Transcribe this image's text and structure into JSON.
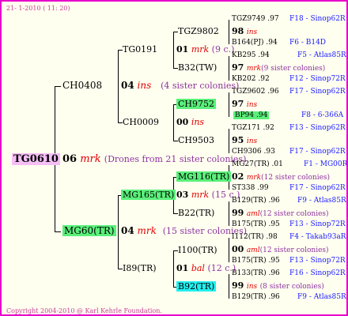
{
  "header": "21-  1-2010 ( 11: 20)",
  "footer": "Copyright 2004-2010 @ Karl Kehrle Foundation.",
  "root": {
    "id": "TG0610",
    "year": "06",
    "type": "mrk",
    "note": "(Drones from 21 sister colonies)"
  },
  "queens": {
    "upper": {
      "id": "CH0408",
      "year": "04",
      "type": "ins",
      "note": "(4 sister colonies)"
    },
    "lower": {
      "id": "MG60(TR)",
      "year": "04",
      "type": "mrk",
      "note": "(15 sister colonies)"
    }
  },
  "gen3": {
    "a": {
      "id": "TG0191",
      "year": "01",
      "type": "mrk",
      "note": "(9 c.)"
    },
    "b": {
      "id": "CH0009",
      "year": "00",
      "type": "ins"
    },
    "c": {
      "id": "MG165(TR)",
      "year": "03",
      "type": "mrk",
      "note": "(15 c.)"
    },
    "d": {
      "id": "I89(TR)",
      "year": "01",
      "type": "bal",
      "note": "(12 c.)"
    }
  },
  "gen4": {
    "a1": "TGZ9802",
    "a2": "B32(TW)",
    "b1": "CH9752",
    "b2": "CH9503",
    "c1": "MG116(TR)",
    "c2": "B22(TR)",
    "d1": "I100(TR)",
    "d2": "B92(TR)"
  },
  "gen5": [
    {
      "id": "TGZ9749",
      "year": ".97",
      "loc": "F18 - Sinop62R"
    },
    {
      "year": "98",
      "type": "ins"
    },
    {
      "id": "B164(PJ)",
      "year": ".94",
      "loc": "F6 - B14D"
    },
    {
      "id": "KB295",
      "year": ".94",
      "loc": "F5 - Atlas85R"
    },
    {
      "year": "97",
      "type": "mrk",
      "note": "(9 sister colonies)"
    },
    {
      "id": "KB202",
      "year": ".92",
      "loc": "F12 - Sinop72R"
    },
    {
      "id": "TGZ9602",
      "year": ".96",
      "loc": "F17 - Sinop62R"
    },
    {
      "year": "97",
      "type": "ins"
    },
    {
      "id": "BP94",
      "year": ".94",
      "loc": "F8 - 6-366A"
    },
    {
      "id": "TGZ171",
      "year": ".92",
      "loc": "F13 - Sinop62R"
    },
    {
      "year": "95",
      "type": "ins"
    },
    {
      "id": "CH9306",
      "year": ".93",
      "loc": "F17 - Sinop62R"
    },
    {
      "id": "MG27(TR)",
      "year": ".01",
      "loc": "F1 - MG00R"
    },
    {
      "year": "02",
      "type": "mrk",
      "note": "(12 sister colonies)"
    },
    {
      "id": "ST338",
      "year": ".99",
      "loc": "F17 - Sinop62R"
    },
    {
      "id": "B129(TR)",
      "year": ".96",
      "loc": "F9 - Atlas85R"
    },
    {
      "year": "99",
      "type": "aml",
      "note": "(12 sister colonies)"
    },
    {
      "id": "B175(TR)",
      "year": ".95",
      "loc": "F13 - Sinop72R"
    },
    {
      "id": "I112(TR)",
      "year": ".98",
      "loc": "F4 - Takab93aR"
    },
    {
      "year": "00",
      "type": "aml",
      "note": "(12 sister colonies)"
    },
    {
      "id": "B175(TR)",
      "year": ".95",
      "loc": "F13 - Sinop72R"
    },
    {
      "id": "B133(TR)",
      "year": ".96",
      "loc": "F16 - Sinop62R"
    },
    {
      "year": "99",
      "type": "ins",
      "note": "(8 sister colonies)"
    },
    {
      "id": "B129(TR)",
      "year": ".96",
      "loc": "F9 - Atlas85R"
    }
  ],
  "colors": {
    "frame": "#e600cc",
    "background": "#fffff0",
    "highlight_green": "#5af07a",
    "highlight_cyan": "#22f0f0",
    "highlight_root": "#f5bef5",
    "location_blue": "#1a1aff",
    "note_purple": "#8c32a0",
    "type_red": "#e00000"
  }
}
